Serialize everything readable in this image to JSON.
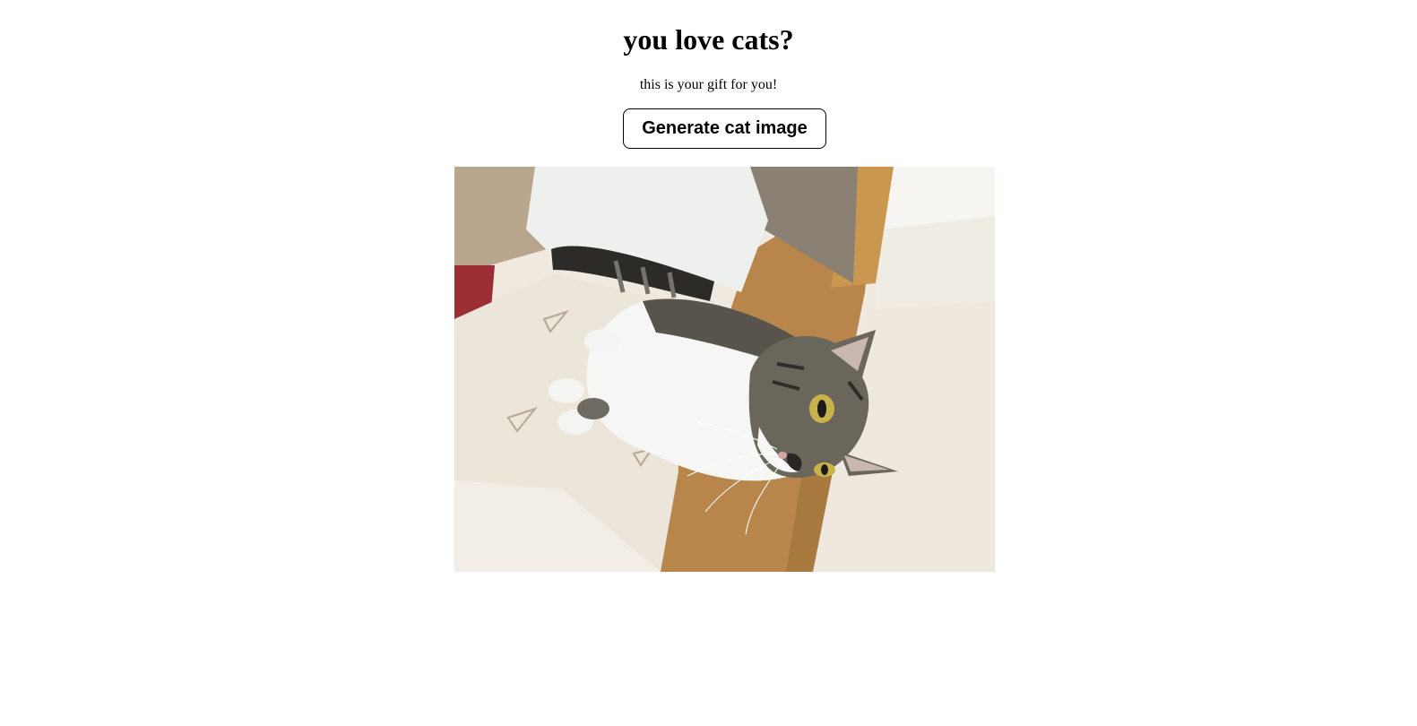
{
  "page": {
    "title": "you love cats?",
    "subtitle": "this is your gift for you!"
  },
  "controls": {
    "generate_label": "Generate cat image"
  },
  "image": {
    "icon": "cat-photo",
    "colors": {
      "wood": "#b98a4e",
      "sheet": "#f1ede6",
      "pillow": "#ece9e2",
      "cat_white": "#f7f7f7",
      "cat_tabby": "#5b574f"
    }
  }
}
